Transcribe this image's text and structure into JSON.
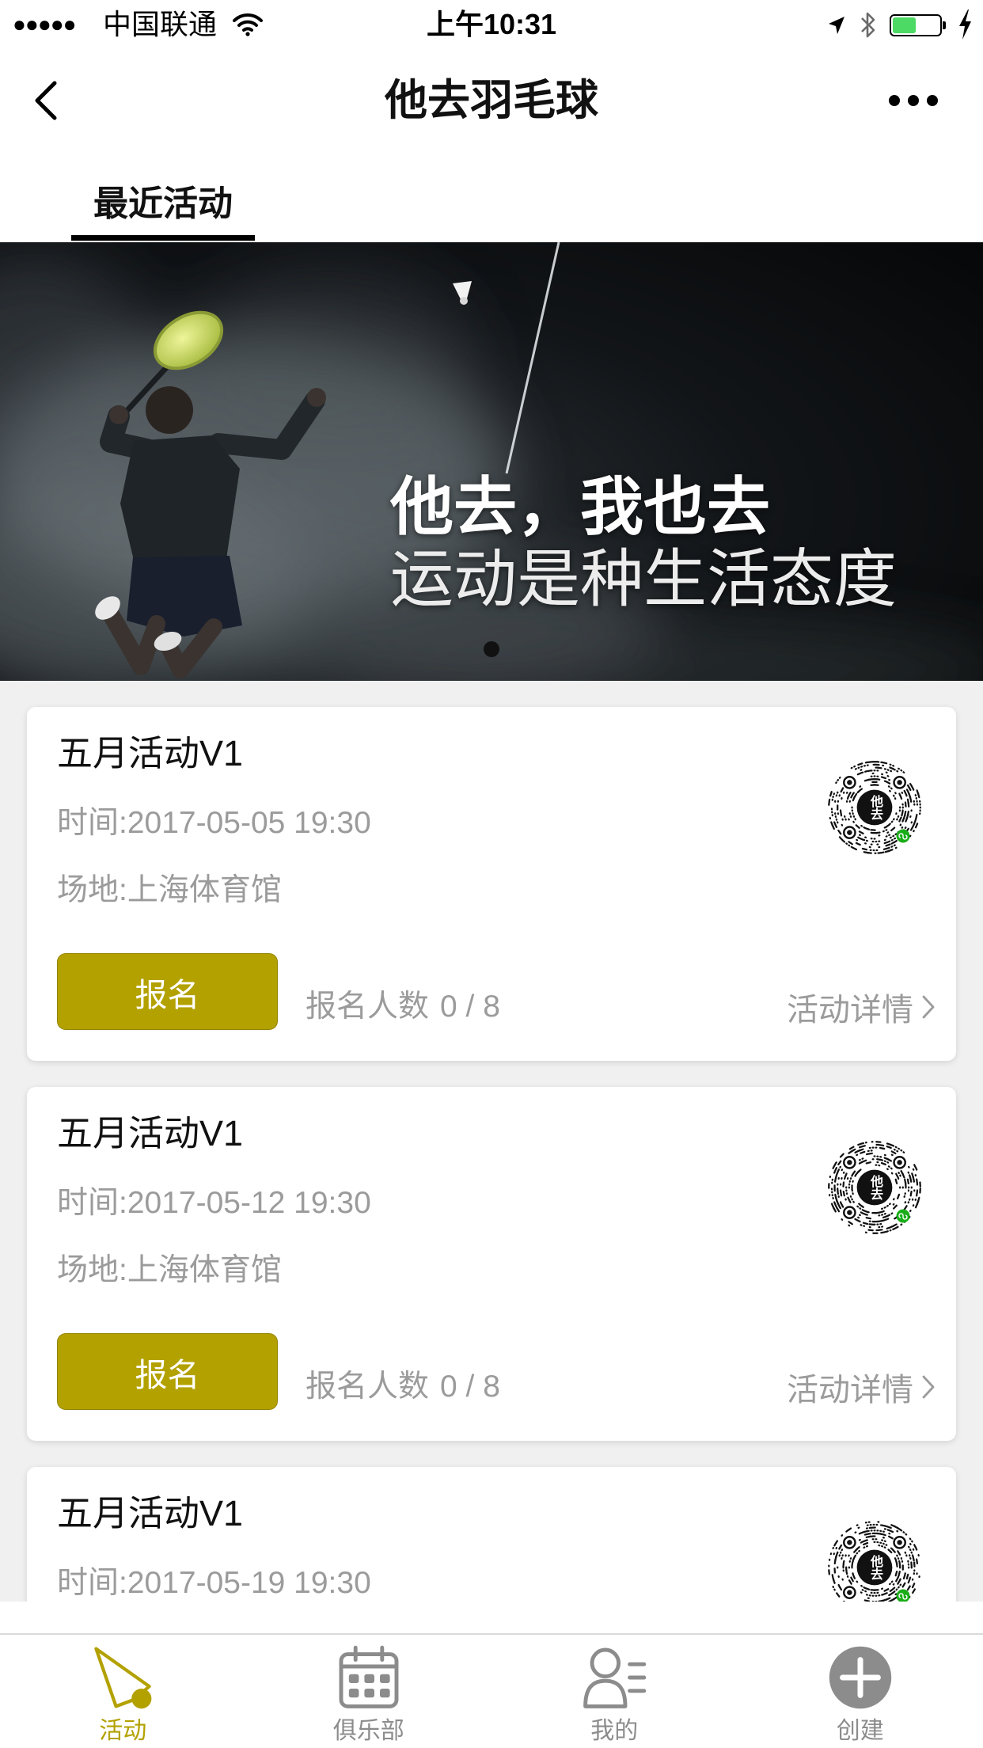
{
  "status_bar": {
    "signal": "●●●●●",
    "carrier": "中国联通",
    "time": "上午10:31",
    "battery_level": 0.5,
    "icons": [
      "wifi-icon",
      "location-icon",
      "bluetooth-icon",
      "battery-icon",
      "charging-icon"
    ]
  },
  "nav": {
    "title": "他去羽毛球",
    "back_icon": "chevron-left-icon",
    "more_icon": "more-icon"
  },
  "tabs": [
    {
      "label": "最近活动",
      "active": true
    }
  ],
  "banner": {
    "headline": "他去，我也去",
    "tagline": "运动是种生活态度"
  },
  "activities": [
    {
      "title": "五月活动V1",
      "time": "时间:2017-05-05 19:30",
      "venue": "场地:上海体育馆",
      "signup_label": "报名",
      "count_label": "报名人数",
      "count": "0 / 8",
      "detail_label": "活动详情",
      "code_logo": "他去"
    },
    {
      "title": "五月活动V1",
      "time": "时间:2017-05-12 19:30",
      "venue": "场地:上海体育馆",
      "signup_label": "报名",
      "count_label": "报名人数",
      "count": "0 / 8",
      "detail_label": "活动详情",
      "code_logo": "他去"
    },
    {
      "title": "五月活动V1",
      "time": "时间:2017-05-19 19:30",
      "code_logo": "他去"
    }
  ],
  "tabbar": {
    "items": [
      {
        "label": "活动",
        "icon": "shuttlecock-icon",
        "active": true
      },
      {
        "label": "俱乐部",
        "icon": "calendar-icon",
        "active": false
      },
      {
        "label": "我的",
        "icon": "profile-icon",
        "active": false
      },
      {
        "label": "创建",
        "icon": "add-icon",
        "active": false
      }
    ]
  },
  "colors": {
    "accent": "#b3a100",
    "secondary": "#9b9b9b",
    "tab-inactive": "#8c8c8c",
    "battery": "#4cd964",
    "page-bg": "#f0f0f0"
  }
}
